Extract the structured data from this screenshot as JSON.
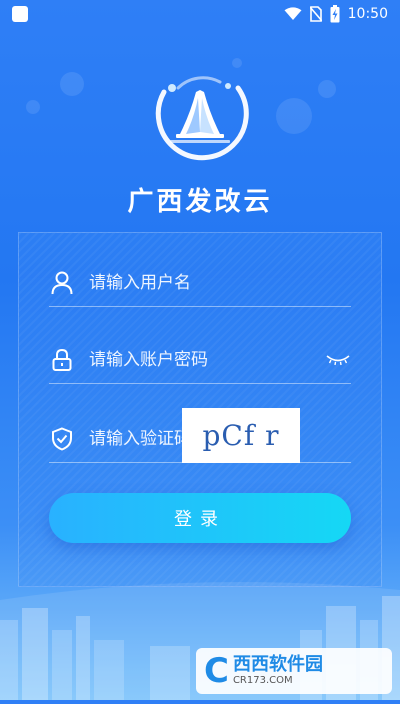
{
  "status_bar": {
    "time": "10:50",
    "icons": [
      "app-icon",
      "wifi-icon",
      "no-sim-icon",
      "battery-charging-icon"
    ]
  },
  "app": {
    "title": "广西发改云",
    "logo": "stadium-logo-icon"
  },
  "form": {
    "username": {
      "placeholder": "请输入用户名",
      "value": "",
      "icon": "user-icon"
    },
    "password": {
      "placeholder": "请输入账户密码",
      "value": "",
      "icon": "lock-icon",
      "toggle_icon": "eye-closed-icon"
    },
    "captcha": {
      "placeholder": "请输入验证码",
      "value": "",
      "icon": "shield-check-icon",
      "image_text": "pCf r"
    },
    "login_label": "登录"
  },
  "watermark": {
    "letter": "C",
    "name": "西西软件园",
    "url": "CR173.COM"
  },
  "colors": {
    "background": "#2377f2",
    "button_start": "#29b1ff",
    "button_end": "#15d8f5",
    "captcha_text": "#2a5db0"
  }
}
